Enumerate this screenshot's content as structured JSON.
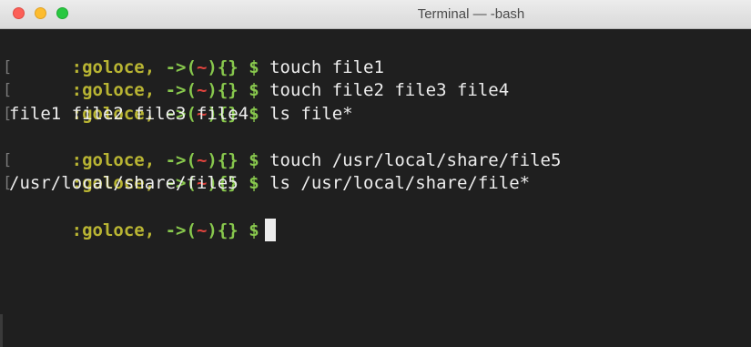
{
  "window": {
    "title": "Terminal — -bash"
  },
  "prompt": {
    "user": ":goloce,",
    "arrow": "->(",
    "tilde": "~",
    "close_paren": ")",
    "braces": "{}",
    "dollar": "$",
    "bracket": "["
  },
  "lines": [
    {
      "type": "command",
      "text": "touch file1"
    },
    {
      "type": "command",
      "text": "touch file2 file3 file4"
    },
    {
      "type": "command",
      "text": "ls file*"
    },
    {
      "type": "output",
      "text": "file1 file2 file3 file4"
    },
    {
      "type": "command",
      "text": "touch /usr/local/share/file5"
    },
    {
      "type": "command",
      "text": "ls /usr/local/share/file*"
    },
    {
      "type": "output",
      "text": "/usr/local/share/file5"
    },
    {
      "type": "prompt",
      "text": ""
    }
  ],
  "colors": {
    "background": "#1f1f1f",
    "user": "#b9b533",
    "green": "#88c84d",
    "tilde": "#e0443e",
    "text": "#ededed"
  }
}
